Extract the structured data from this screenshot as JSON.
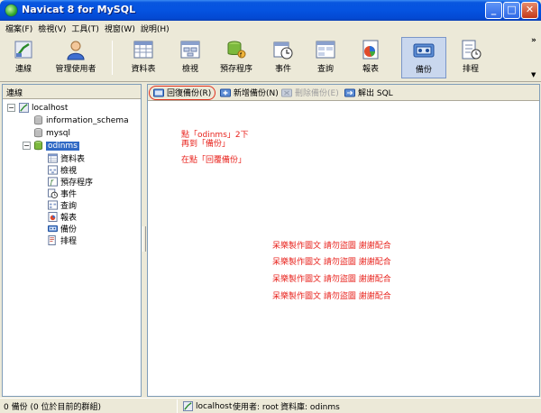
{
  "window": {
    "title": "Navicat 8 for MySQL",
    "min_glyph": "_",
    "max_glyph": "□",
    "close_glyph": "✕"
  },
  "menu": [
    {
      "label": "檔案(F)"
    },
    {
      "label": "檢視(V)"
    },
    {
      "label": "工具(T)"
    },
    {
      "label": "視窗(W)"
    },
    {
      "label": "說明(H)"
    }
  ],
  "toolbar": {
    "connect": "連線",
    "manage_users": "管理使用者",
    "tables": "資料表",
    "views": "檢視",
    "procedures": "預存程序",
    "events": "事件",
    "queries": "查詢",
    "reports": "報表",
    "backup": "備份",
    "schedule": "排程",
    "more": "»",
    "dropdown": "▼"
  },
  "left": {
    "header": "連線",
    "tree": {
      "connection": "localhost",
      "dbs": [
        "information_schema",
        "mysql",
        "odinms"
      ],
      "children": [
        "資料表",
        "檢視",
        "預存程序",
        "事件",
        "查詢",
        "報表",
        "備份",
        "排程"
      ]
    }
  },
  "subtoolbar": {
    "restore": "回復備份(R)",
    "new_backup": "新增備份(N)",
    "delete_backup": "刪除備份(E)",
    "export_sql": "解出 SQL"
  },
  "annotations": {
    "line1": "點「odinms」2下",
    "line2": "再到「備份」",
    "line3": "在點「回覆備份」",
    "credit": [
      "呆樂製作圖文 請勿盜圖 謝謝配合",
      "呆樂製作圖文 請勿盜圖 謝謝配合",
      "呆樂製作圖文 請勿盜圖 謝謝配合",
      "呆樂製作圖文 請勿盜圖 謝謝配合"
    ]
  },
  "status": {
    "left": "0 備份 (0 位於目前的群組)",
    "connection": "localhost",
    "user": "使用者: root",
    "database": "資料庫: odinms"
  },
  "colors": {
    "annotation": "#e8221c",
    "selection": "#316ac5",
    "titlebar": "#0553e0"
  }
}
